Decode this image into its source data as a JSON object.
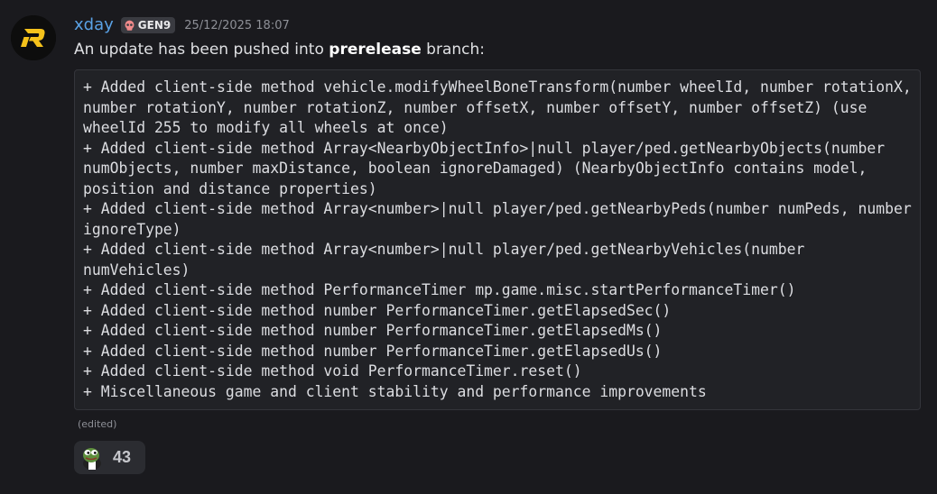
{
  "message": {
    "username": "xday",
    "role_badge": "GEN9",
    "badge_icon": "skull-icon",
    "avatar_letter": "R",
    "timestamp": "25/12/2025 18:07",
    "intro_prefix": "An update has been pushed into ",
    "intro_branch": "prerelease",
    "intro_suffix": " branch:",
    "code_lines": [
      "+ Added client-side method vehicle.modifyWheelBoneTransform(number wheelId, number rotationX, number rotationY, number rotationZ, number offsetX, number offsetY, number offsetZ) (use wheelId 255 to modify all wheels at once)",
      "+ Added client-side method Array<NearbyObjectInfo>|null player/ped.getNearbyObjects(number numObjects, number maxDistance, boolean ignoreDamaged) (NearbyObjectInfo contains model, position and distance properties)",
      "+ Added client-side method Array<number>|null player/ped.getNearbyPeds(number numPeds, number ignoreType)",
      "+ Added client-side method Array<number>|null player/ped.getNearbyVehicles(number numVehicles)",
      "+ Added client-side method PerformanceTimer mp.game.misc.startPerformanceTimer()",
      "+ Added client-side method number PerformanceTimer.getElapsedSec()",
      "+ Added client-side method number PerformanceTimer.getElapsedMs()",
      "+ Added client-side method number PerformanceTimer.getElapsedUs()",
      "+ Added client-side method void PerformanceTimer.reset()",
      "+ Miscellaneous game and client stability and performance improvements"
    ],
    "edited_label": "(edited)"
  },
  "reaction": {
    "emoji_icon": "pepe-frog-emoji-icon",
    "count": "43"
  },
  "colors": {
    "background": "#1a1a1e",
    "username": "#5aa2e6",
    "code_background": "#212226",
    "avatar_accent": "#f5c21b"
  }
}
